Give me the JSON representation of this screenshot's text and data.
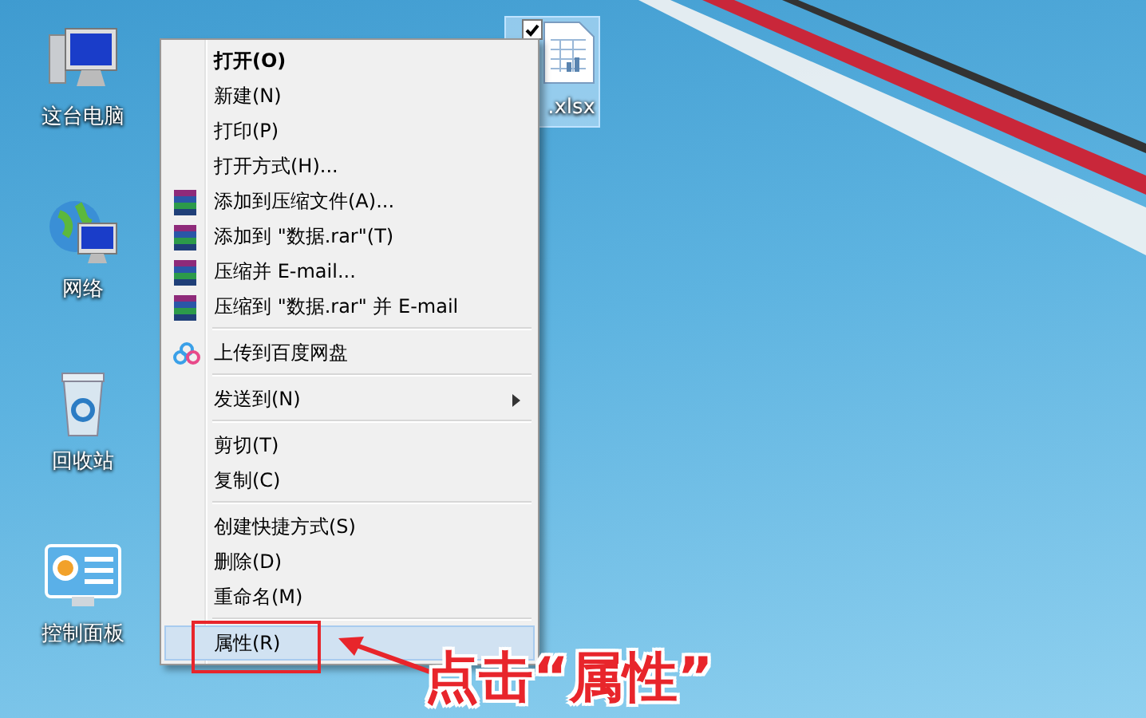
{
  "desktop_icons": [
    {
      "kind": "computer",
      "label": "这台电脑"
    },
    {
      "kind": "network",
      "label": "网络"
    },
    {
      "kind": "recycle",
      "label": "回收站"
    },
    {
      "kind": "control",
      "label": "控制面板"
    }
  ],
  "file_icon": {
    "label": ".xlsx",
    "selected": true,
    "checked": true
  },
  "context_menu": [
    {
      "kind": "default",
      "label": "打开(O)",
      "selected": false
    },
    {
      "kind": "plain",
      "label": "新建(N)",
      "selected": false
    },
    {
      "kind": "plain",
      "label": "打印(P)",
      "selected": false
    },
    {
      "kind": "plain",
      "label": "打开方式(H)...",
      "selected": false
    },
    {
      "kind": "archive",
      "label": "添加到压缩文件(A)...",
      "selected": false
    },
    {
      "kind": "archive",
      "label": "添加到 \"数据.rar\"(T)",
      "selected": false
    },
    {
      "kind": "archive",
      "label": "压缩并 E-mail...",
      "selected": false
    },
    {
      "kind": "archive",
      "label": "压缩到 \"数据.rar\" 并 E-mail",
      "selected": false
    },
    {
      "kind": "separator"
    },
    {
      "kind": "cloud",
      "label": "上传到百度网盘",
      "selected": false
    },
    {
      "kind": "separator"
    },
    {
      "kind": "submenu",
      "label": "发送到(N)",
      "selected": false
    },
    {
      "kind": "separator"
    },
    {
      "kind": "plain",
      "label": "剪切(T)",
      "selected": false
    },
    {
      "kind": "plain",
      "label": "复制(C)",
      "selected": false
    },
    {
      "kind": "separator"
    },
    {
      "kind": "plain",
      "label": "创建快捷方式(S)",
      "selected": false
    },
    {
      "kind": "plain",
      "label": "删除(D)",
      "selected": false
    },
    {
      "kind": "plain",
      "label": "重命名(M)",
      "selected": false
    },
    {
      "kind": "separator"
    },
    {
      "kind": "plain",
      "label": "属性(R)",
      "selected": true
    }
  ],
  "annotation": {
    "text": "点击“属性”"
  }
}
